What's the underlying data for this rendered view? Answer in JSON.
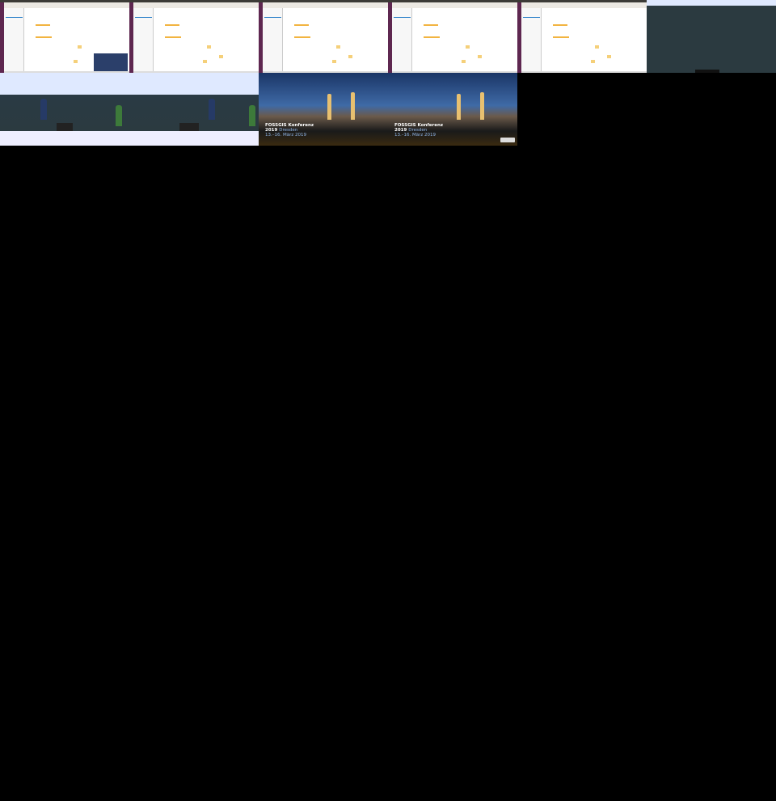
{
  "thumbnails": [
    {
      "kind": "desktop",
      "has_camera": true
    },
    {
      "kind": "desktop"
    },
    {
      "kind": "desktop"
    },
    {
      "kind": "desktop"
    },
    {
      "kind": "desktop"
    },
    {
      "kind": "hall-wall"
    },
    {
      "kind": "hall-speakers"
    },
    {
      "kind": "hall-speakers"
    },
    {
      "kind": "title-slide"
    },
    {
      "kind": "title-slide",
      "has_license": true
    }
  ],
  "title_slide": {
    "line1": "FOSSGIS Konferenz",
    "year": "2019",
    "city": "Dresden",
    "dates": "13.–16. März 2019"
  }
}
